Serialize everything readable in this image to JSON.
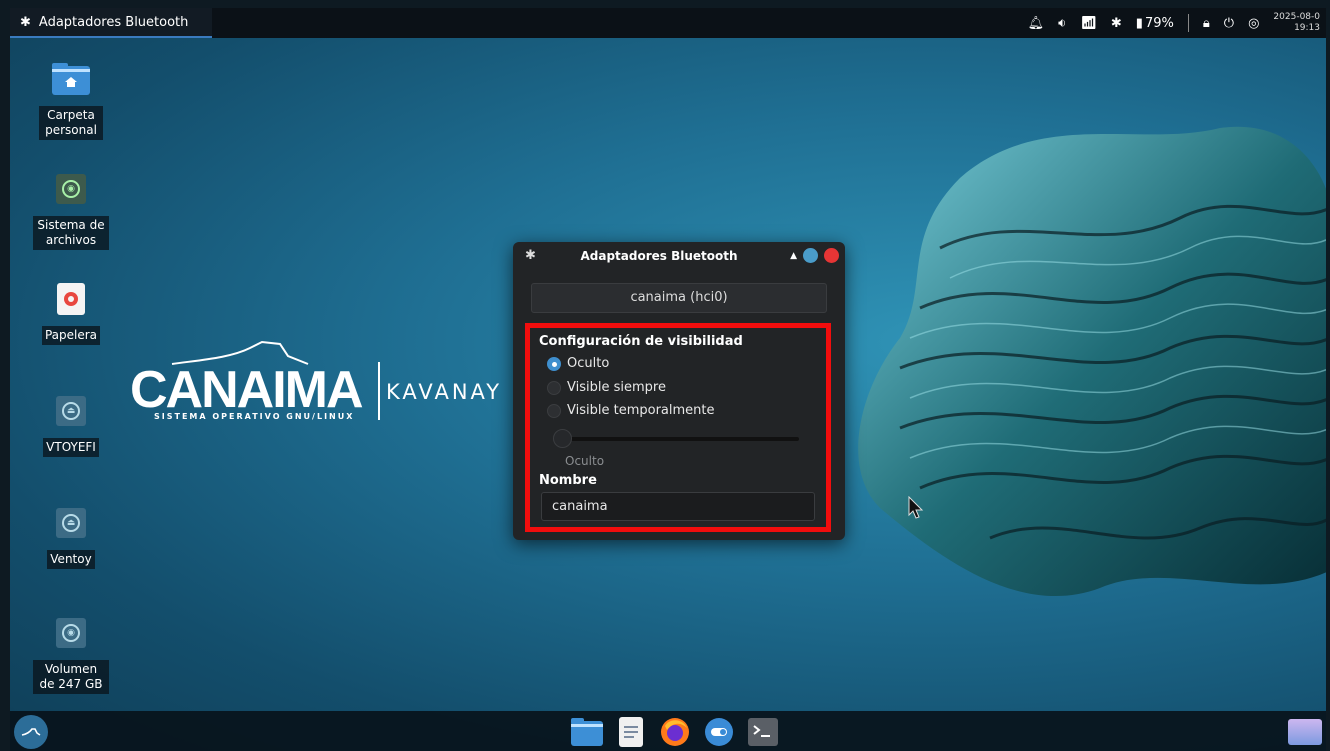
{
  "top_panel": {
    "task_button_label": "Adaptadores Bluetooth",
    "battery_percent": "79%",
    "clock_date": "2025-08-0",
    "clock_time": "19:13"
  },
  "desktop": {
    "items": [
      {
        "label": "Carpeta personal",
        "icon": "home-folder-icon"
      },
      {
        "label": "Sistema de archivos",
        "icon": "filesystem-icon"
      },
      {
        "label": "Papelera",
        "icon": "trash-icon"
      },
      {
        "label": "VTOYEFI",
        "icon": "drive-eject-icon"
      },
      {
        "label": "Ventoy",
        "icon": "drive-eject-icon"
      },
      {
        "label": "Volumen de 247 GB",
        "icon": "drive-icon"
      }
    ]
  },
  "wallpaper": {
    "logo_word": "CANAIMA",
    "logo_subtitle": "SISTEMA OPERATIVO GNU/LINUX",
    "logo_version": "KAVANAY"
  },
  "dialog": {
    "title": "Adaptadores Bluetooth",
    "adapter_tab": "canaima (hci0)",
    "visibility_title": "Configuración de visibilidad",
    "radio_options": [
      {
        "label": "Oculto",
        "selected": true
      },
      {
        "label": "Visible siempre",
        "selected": false
      },
      {
        "label": "Visible temporalmente",
        "selected": false
      }
    ],
    "slider_value": "Oculto",
    "name_title": "Nombre",
    "name_value": "canaima"
  },
  "colors": {
    "highlight": "#f20d0d",
    "accent": "#3f8fce",
    "close_button": "#e63535",
    "minimize_button": "#4a9cc9"
  }
}
